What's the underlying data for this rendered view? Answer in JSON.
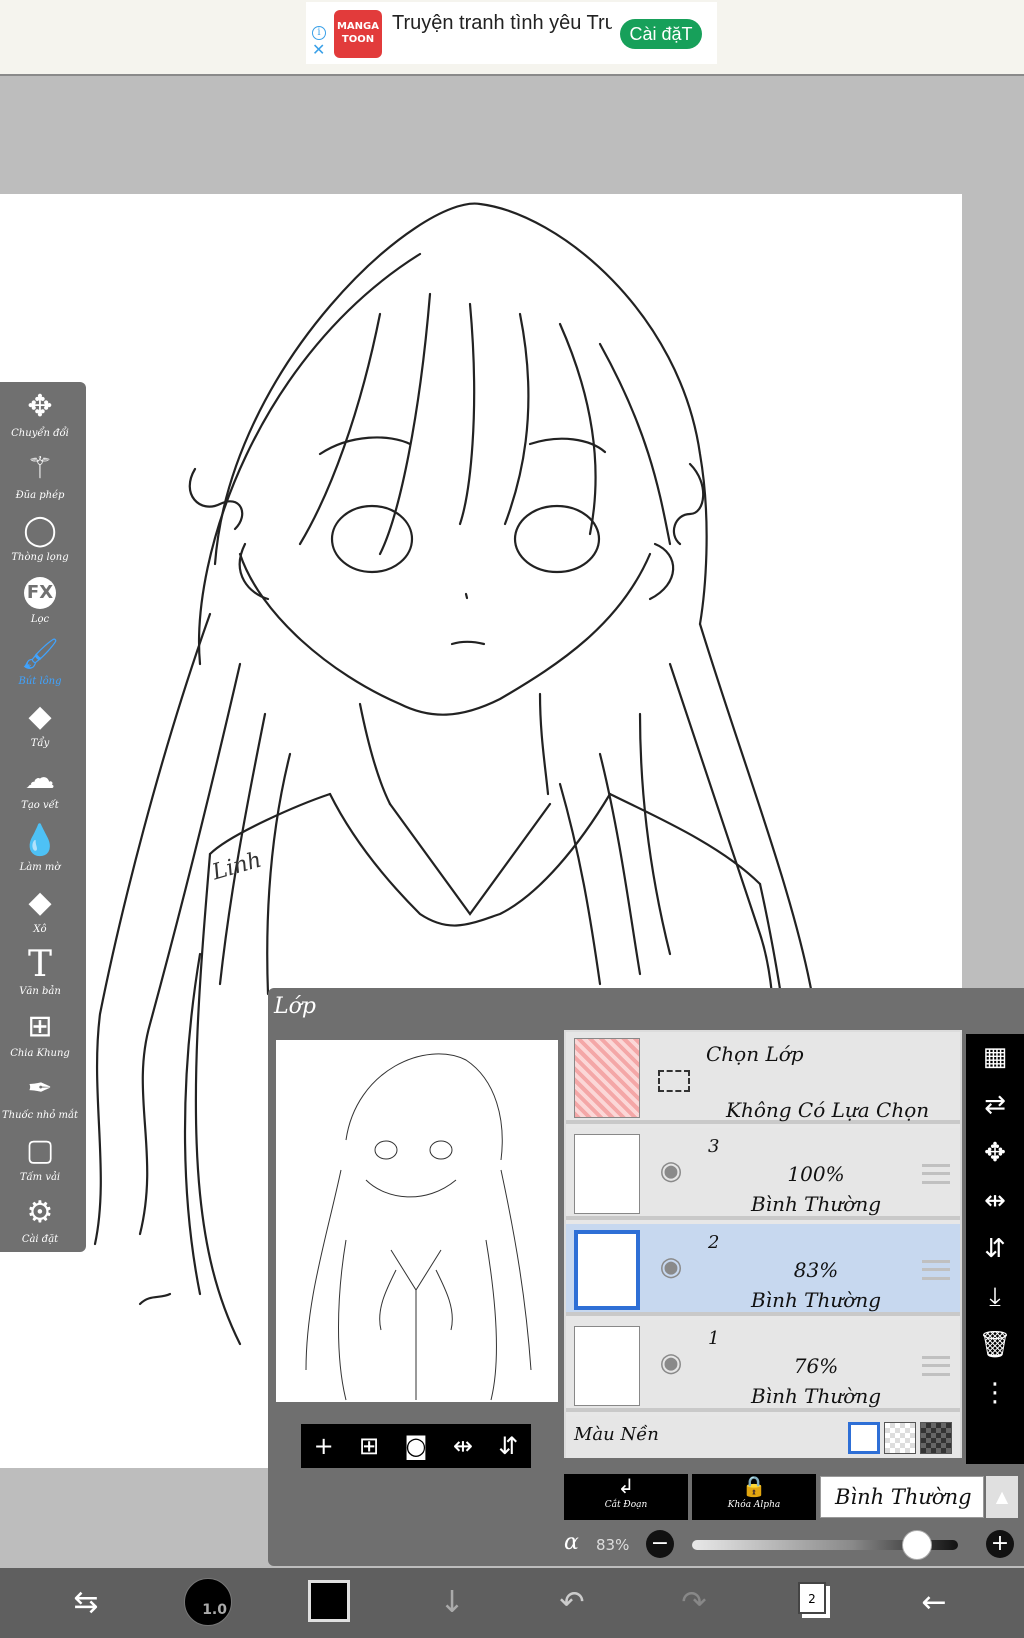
{
  "ad": {
    "logo_line1": "MANGA",
    "logo_line2": "TOON",
    "text": "Truyện tranh tình yêu Truyện tranh người lớn",
    "cta": "Cài đặT"
  },
  "toolbar": {
    "items": [
      {
        "label": "Chuyển đổi",
        "icon": "move-icon"
      },
      {
        "label": "Đũa phép",
        "icon": "magic-wand-icon"
      },
      {
        "label": "Thòng lọng",
        "icon": "lasso-icon"
      },
      {
        "label": "Lọc",
        "icon": "fx-filter-icon"
      },
      {
        "label": "Bút lông",
        "icon": "brush-icon"
      },
      {
        "label": "Tẩy",
        "icon": "eraser-icon"
      },
      {
        "label": "Tạo vết",
        "icon": "smudge-icon"
      },
      {
        "label": "Làm mờ",
        "icon": "blur-drop-icon"
      },
      {
        "label": "Xô",
        "icon": "bucket-icon"
      },
      {
        "label": "Văn bản",
        "icon": "text-icon"
      },
      {
        "label": "Chia Khung",
        "icon": "frame-divider-icon"
      },
      {
        "label": "Thuốc nhỏ mắt",
        "icon": "eyedropper-icon"
      },
      {
        "label": "Tấm vải",
        "icon": "canvas-icon"
      },
      {
        "label": "Cài đặt",
        "icon": "settings-icon"
      }
    ],
    "active_index": 4,
    "active_color": "#3fa3ff"
  },
  "canvas": {
    "signature": "Linh"
  },
  "layer_panel": {
    "title": "Lớp",
    "selection": {
      "title": "Chọn Lớp",
      "subtitle": "Không Có Lựa Chọn"
    },
    "layers": [
      {
        "number": "3",
        "opacity": "100%",
        "mode": "Bình Thường",
        "selected": false
      },
      {
        "number": "2",
        "opacity": "83%",
        "mode": "Bình Thường",
        "selected": true
      },
      {
        "number": "1",
        "opacity": "76%",
        "mode": "Bình Thường",
        "selected": false
      }
    ],
    "background_label": "Màu Nền",
    "clip_label": "Cắt Đoạn",
    "alpha_lock_label": "Khóa Alpha",
    "blend_mode": "Bình Thường",
    "alpha_symbol": "α",
    "alpha_value": "83%",
    "alpha_fraction": 0.83,
    "selected_color": "#c7d8ef"
  },
  "bottom_bar": {
    "brush_size": "1.0",
    "layer_count": "2",
    "current_color": "#000000"
  }
}
